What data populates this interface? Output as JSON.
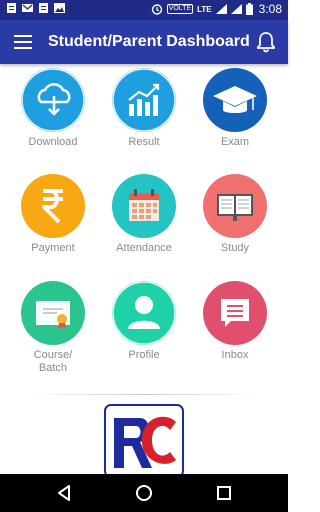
{
  "status_bar": {
    "time": "3:08",
    "network": "LTE",
    "volte": "VOLTE",
    "icons": [
      "notes-icon",
      "gmail-icon",
      "notes-icon",
      "image-icon",
      "alarm-icon",
      "wifi-icon",
      "signal-icon",
      "battery-icon"
    ]
  },
  "app_bar": {
    "title": "Student/Parent Dashboard",
    "menu_icon": "hamburger-menu-icon",
    "notification_icon": "bell-icon"
  },
  "tiles": [
    {
      "label": "Download",
      "icon": "cloud-download-icon",
      "color": "#1f9fe0"
    },
    {
      "label": "Result",
      "icon": "bar-chart-icon",
      "color": "#1f9fe0"
    },
    {
      "label": "Exam",
      "icon": "graduation-cap-icon",
      "color": "#1560b8"
    },
    {
      "label": "Payment",
      "icon": "rupee-icon",
      "color": "#f7a813"
    },
    {
      "label": "Attendance",
      "icon": "calendar-icon",
      "color": "#25c4c4"
    },
    {
      "label": "Study",
      "icon": "book-icon",
      "color": "#f07070"
    },
    {
      "label": "Course/\nBatch",
      "icon": "certificate-icon",
      "color": "#2cc48e"
    },
    {
      "label": "Profile",
      "icon": "user-icon",
      "color": "#1fd1a6"
    },
    {
      "label": "Inbox",
      "icon": "message-icon",
      "color": "#e0506e"
    }
  ],
  "logo": {
    "text": "RC",
    "colors": [
      "#1e2b9a",
      "#d8202a"
    ]
  },
  "nav": {
    "back": "back-icon",
    "home": "home-icon",
    "recents": "recents-icon"
  }
}
